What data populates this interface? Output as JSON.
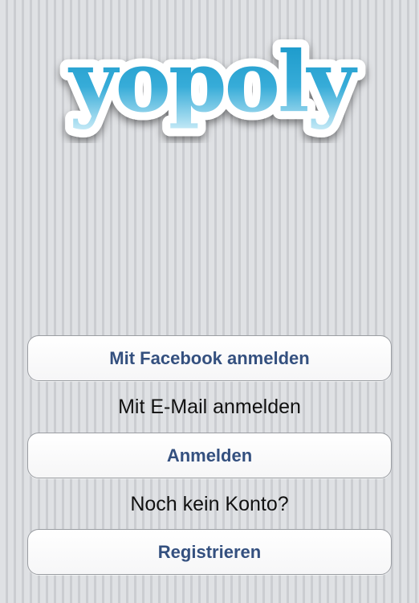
{
  "app": {
    "logo_text": "yopoly"
  },
  "colors": {
    "background": "#d3d5d9",
    "logo_fill_top": "#1ea0cf",
    "logo_fill_bottom": "#bfe6f5",
    "button_text": "#34507f",
    "caption_text": "#111111"
  },
  "login": {
    "facebook_button_label": "Mit Facebook anmelden",
    "email_caption": "Mit E-Mail anmelden",
    "login_button_label": "Anmelden",
    "no_account_caption": "Noch kein Konto?",
    "register_button_label": "Registrieren"
  }
}
